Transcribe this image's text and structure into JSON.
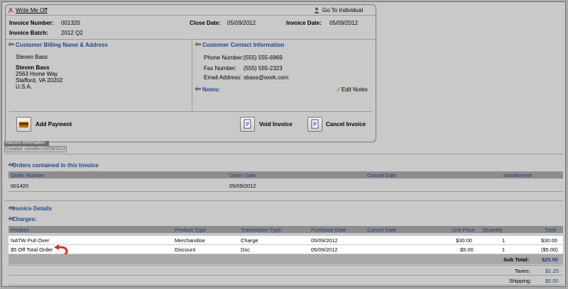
{
  "header": {
    "write_off": "Write Me Off",
    "go_to_individual": "Go To Individual"
  },
  "invoice": {
    "number_label": "Invoice Number:",
    "number": "001320",
    "close_date_label": "Close Date:",
    "close_date": "05/09/2012",
    "invoice_date_label": "Invoice Date:",
    "invoice_date": "05/09/2012",
    "batch_label": "Invoice Batch:",
    "batch": "2012 Q2"
  },
  "billing": {
    "title": "Customer Billing Name & Address",
    "name": "Steven Bass",
    "addr_name": "Steven Bass",
    "street": "2563 Home Way",
    "city": "Stafford, VA 20202",
    "country": "U.S.A."
  },
  "contact": {
    "title": "Customer Contact Information",
    "phone_label": "Phone Number:",
    "phone": "(555) 555-6969",
    "fax_label": "Fax Number:",
    "fax": "(555) 555-2323",
    "email_label": "Email Address:",
    "email": "sbass@work.com",
    "notes_label": "Notes:",
    "edit_notes": "Edit Notes"
  },
  "actions": {
    "add_payment": "Add Payment",
    "void_invoice": "Void Invoice",
    "cancel_invoice": "Cancel Invoice"
  },
  "record": {
    "title": "Record Information",
    "created": "Created: sshaffer-05/09/2012"
  },
  "orders": {
    "title": "Orders contained in this Invoice",
    "headers": [
      "Order Number",
      "Order Date",
      "Cancel Date",
      "Installment#"
    ],
    "rows": [
      [
        "001420",
        "05/09/2012",
        "",
        ""
      ]
    ]
  },
  "details": {
    "title": "Invoice Details",
    "charges_title": "Charges:",
    "headers": [
      "Product",
      "Product Type",
      "Transaction Type",
      "Purchase Date",
      "Cancel Date",
      "Unit Price",
      "Quantity",
      "Total"
    ],
    "rows": [
      [
        "NATW Pull Over",
        "Merchandise",
        "Charge",
        "05/09/2012",
        "",
        "$30.00",
        "1",
        "$30.00"
      ],
      [
        "$5 Off Total Order",
        "Discount",
        "Dsc",
        "05/09/2012",
        "",
        "$5.00",
        "1",
        "($5.00)"
      ]
    ],
    "subtotal_label": "Sub Total:",
    "subtotal": "$25.00",
    "taxes_label": "Taxes:",
    "taxes": "$1.25",
    "shipping_label": "Shipping:",
    "shipping": "$0.00"
  },
  "colors": {
    "accent": "#20498b",
    "header_bar": "#8d8d8d",
    "background": "#c9c9c9"
  }
}
